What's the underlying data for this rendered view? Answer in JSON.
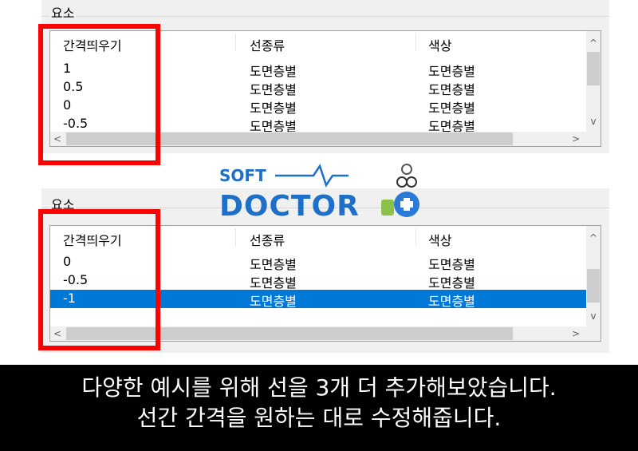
{
  "top_panel": {
    "group_label": "요소",
    "columns": [
      "간격띄우기",
      "선종류",
      "색상"
    ],
    "rows": [
      [
        "1",
        "도면층별",
        "도면층별"
      ],
      [
        "0.5",
        "도면층별",
        "도면층별"
      ],
      [
        "0",
        "도면층별",
        "도면층별"
      ],
      [
        "-0.5",
        "도면층별",
        "도면층별"
      ]
    ]
  },
  "bottom_panel": {
    "group_label": "요소",
    "columns": [
      "간격띄우기",
      "선종류",
      "색상"
    ],
    "rows": [
      [
        "0",
        "도면층별",
        "도면층별"
      ],
      [
        "-0.5",
        "도면층별",
        "도면층별"
      ],
      [
        "-1",
        "도면층별",
        "도면층별"
      ]
    ],
    "selected_row": 2
  },
  "logo": {
    "line1": "SOFT",
    "line2": "DOCTOR"
  },
  "caption": {
    "line1": "다양한 예시를 위해 선을 3개 더 추가해보았습니다.",
    "line2": "선간 간격을 원하는 대로 수정해줍니다."
  },
  "scroll_arrows": {
    "up": "^",
    "down": "v",
    "left": "<",
    "right": ">"
  },
  "colors": {
    "highlight": "#ff0000",
    "selection": "#0078d7",
    "logo": "#1e6fc8"
  }
}
